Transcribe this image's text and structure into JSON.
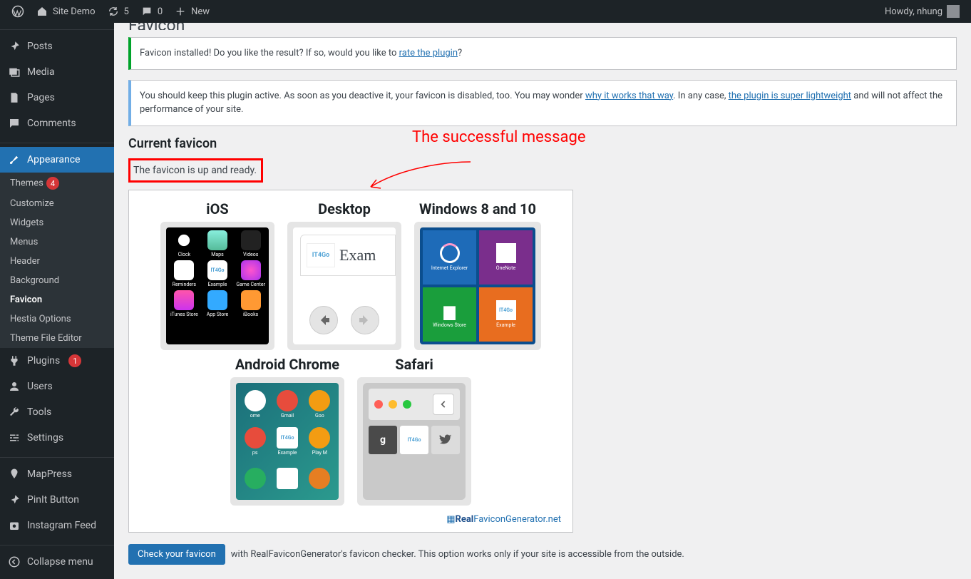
{
  "adminbar": {
    "site_name": "Site Demo",
    "updates_count": "5",
    "comments_count": "0",
    "new_label": "New",
    "howdy": "Howdy, nhung"
  },
  "sidebar": {
    "posts": "Posts",
    "media": "Media",
    "pages": "Pages",
    "comments": "Comments",
    "appearance": "Appearance",
    "appearance_sub": {
      "themes": "Themes",
      "themes_badge": "4",
      "customize": "Customize",
      "widgets": "Widgets",
      "menus": "Menus",
      "header": "Header",
      "background": "Background",
      "favicon": "Favicon",
      "hestia": "Hestia Options",
      "editor": "Theme File Editor"
    },
    "plugins": "Plugins",
    "plugins_badge": "1",
    "users": "Users",
    "tools": "Tools",
    "settings": "Settings",
    "mappress": "MapPress",
    "pinit": "PinIt Button",
    "instagram": "Instagram Feed",
    "collapse": "Collapse menu"
  },
  "page": {
    "title": "Favicon",
    "notice1_pre": "Favicon installed! Do you like the result? If so, would you like to ",
    "notice1_link": "rate the plugin",
    "notice1_post": "?",
    "notice2_pre": "You should keep this plugin active. As soon as you deactive it, your favicon is disabled, too. You may wonder ",
    "notice2_link1": "why it works that way",
    "notice2_mid": ". In any case, ",
    "notice2_link2": "the plugin is super lightweight",
    "notice2_post": " and will not affect the performance of your site.",
    "section_title": "Current favicon",
    "status": "The favicon is up and ready.",
    "annotation": "The successful message",
    "previews": {
      "ios": "iOS",
      "desktop": "Desktop",
      "windows": "Windows 8 and 10",
      "android": "Android Chrome",
      "safari": "Safari"
    },
    "ios_apps": [
      "Clock",
      "Maps",
      "Videos",
      "Reminders",
      "Example",
      "Game Center",
      "iTunes Store",
      "App Store",
      "iBooks"
    ],
    "desktop_fav_text": "IT4Go",
    "desktop_title": "Exam",
    "win_tiles": [
      "Internet Explorer",
      "OneNote",
      "Windows Store",
      "Example"
    ],
    "android_apps": [
      "ome",
      "Gmail",
      "Goo",
      "ps",
      "Example",
      "Play M"
    ],
    "rfg_prefix_icon": "▦",
    "rfg_text_bold": "Real",
    "rfg_text_rest": "FaviconGenerator.net",
    "check_button": "Check your favicon",
    "check_text": "with RealFaviconGenerator's favicon checker. This option works only if your site is accessible from the outside."
  }
}
